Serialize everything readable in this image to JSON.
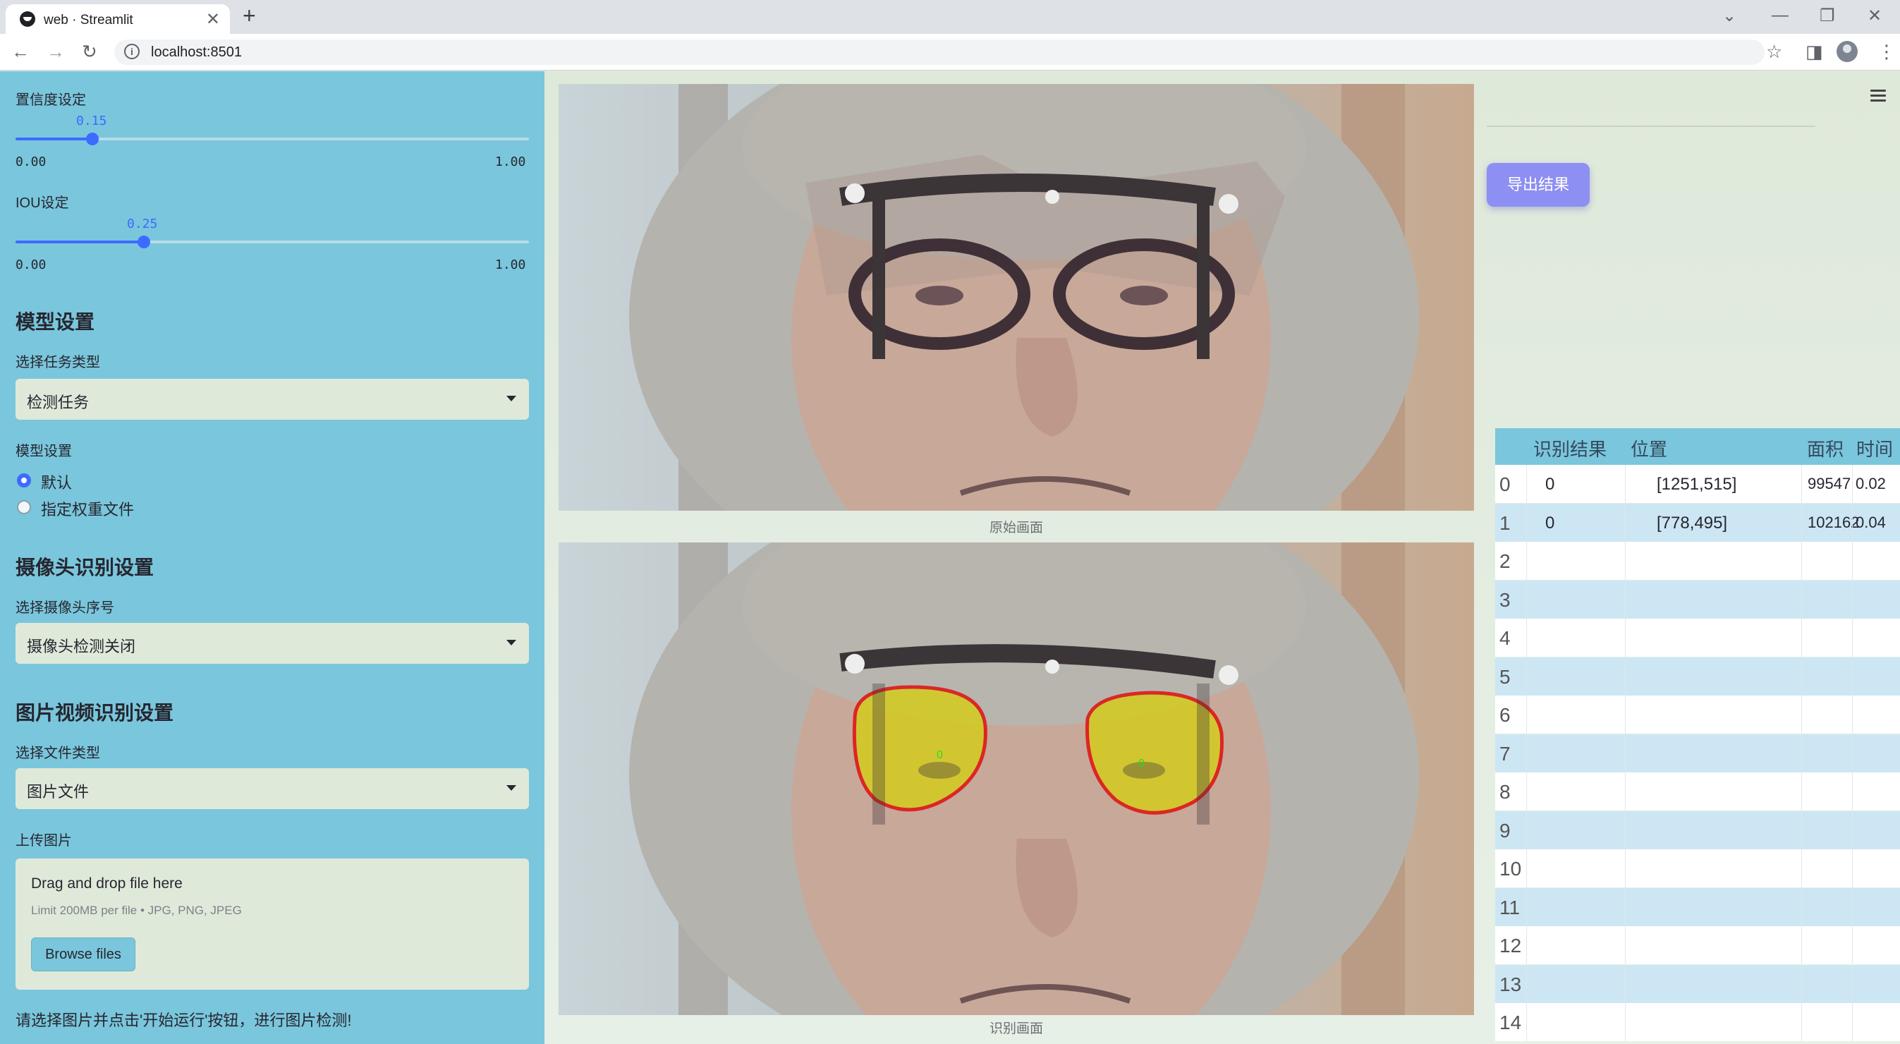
{
  "browser": {
    "tab_title": "web · Streamlit",
    "url": "localhost:8501"
  },
  "sidebar": {
    "confidence": {
      "label": "置信度设定",
      "value": "0.15",
      "value_fraction": 0.15,
      "min": "0.00",
      "max": "1.00"
    },
    "iou": {
      "label": "IOU设定",
      "value": "0.25",
      "value_fraction": 0.25,
      "min": "0.00",
      "max": "1.00"
    },
    "model_section": "模型设置",
    "task_label": "选择任务类型",
    "task_value": "检测任务",
    "model_label": "模型设置",
    "model_options": [
      "默认",
      "指定权重文件"
    ],
    "model_selected": 0,
    "camera_section": "摄像头识别设置",
    "camera_label": "选择摄像头序号",
    "camera_value": "摄像头检测关闭",
    "media_section": "图片视频识别设置",
    "file_type_label": "选择文件类型",
    "file_type_value": "图片文件",
    "upload_label": "上传图片",
    "upload_title": "Drag and drop file here",
    "upload_limit": "Limit 200MB per file • JPG, PNG, JPEG",
    "browse_label": "Browse files",
    "hint": "请选择图片并点击'开始运行'按钮，进行图片检测!"
  },
  "main": {
    "original_caption": "原始画面",
    "result_caption": "识别画面",
    "export_label": "导出结果",
    "detection_label": "0",
    "table": {
      "columns": [
        "识别结果",
        "位置",
        "面积",
        "时间"
      ],
      "rows": [
        {
          "idx": "0",
          "result": "0",
          "position": "[1251,515]",
          "area": "99547",
          "time": "0.02"
        },
        {
          "idx": "1",
          "result": "0",
          "position": "[778,495]",
          "area": "102162",
          "time": "0.04"
        },
        {
          "idx": "2"
        },
        {
          "idx": "3"
        },
        {
          "idx": "4"
        },
        {
          "idx": "5"
        },
        {
          "idx": "6"
        },
        {
          "idx": "7"
        },
        {
          "idx": "8"
        },
        {
          "idx": "9"
        },
        {
          "idx": "10"
        },
        {
          "idx": "11"
        },
        {
          "idx": "12"
        },
        {
          "idx": "13"
        },
        {
          "idx": "14"
        }
      ]
    }
  },
  "colors": {
    "sidebar_bg": "#7ac6dc",
    "accent": "#3d6bff",
    "export_button": "#8e8ff2",
    "mask_fill": "#d4cc1e",
    "mask_outline": "#e01010"
  }
}
